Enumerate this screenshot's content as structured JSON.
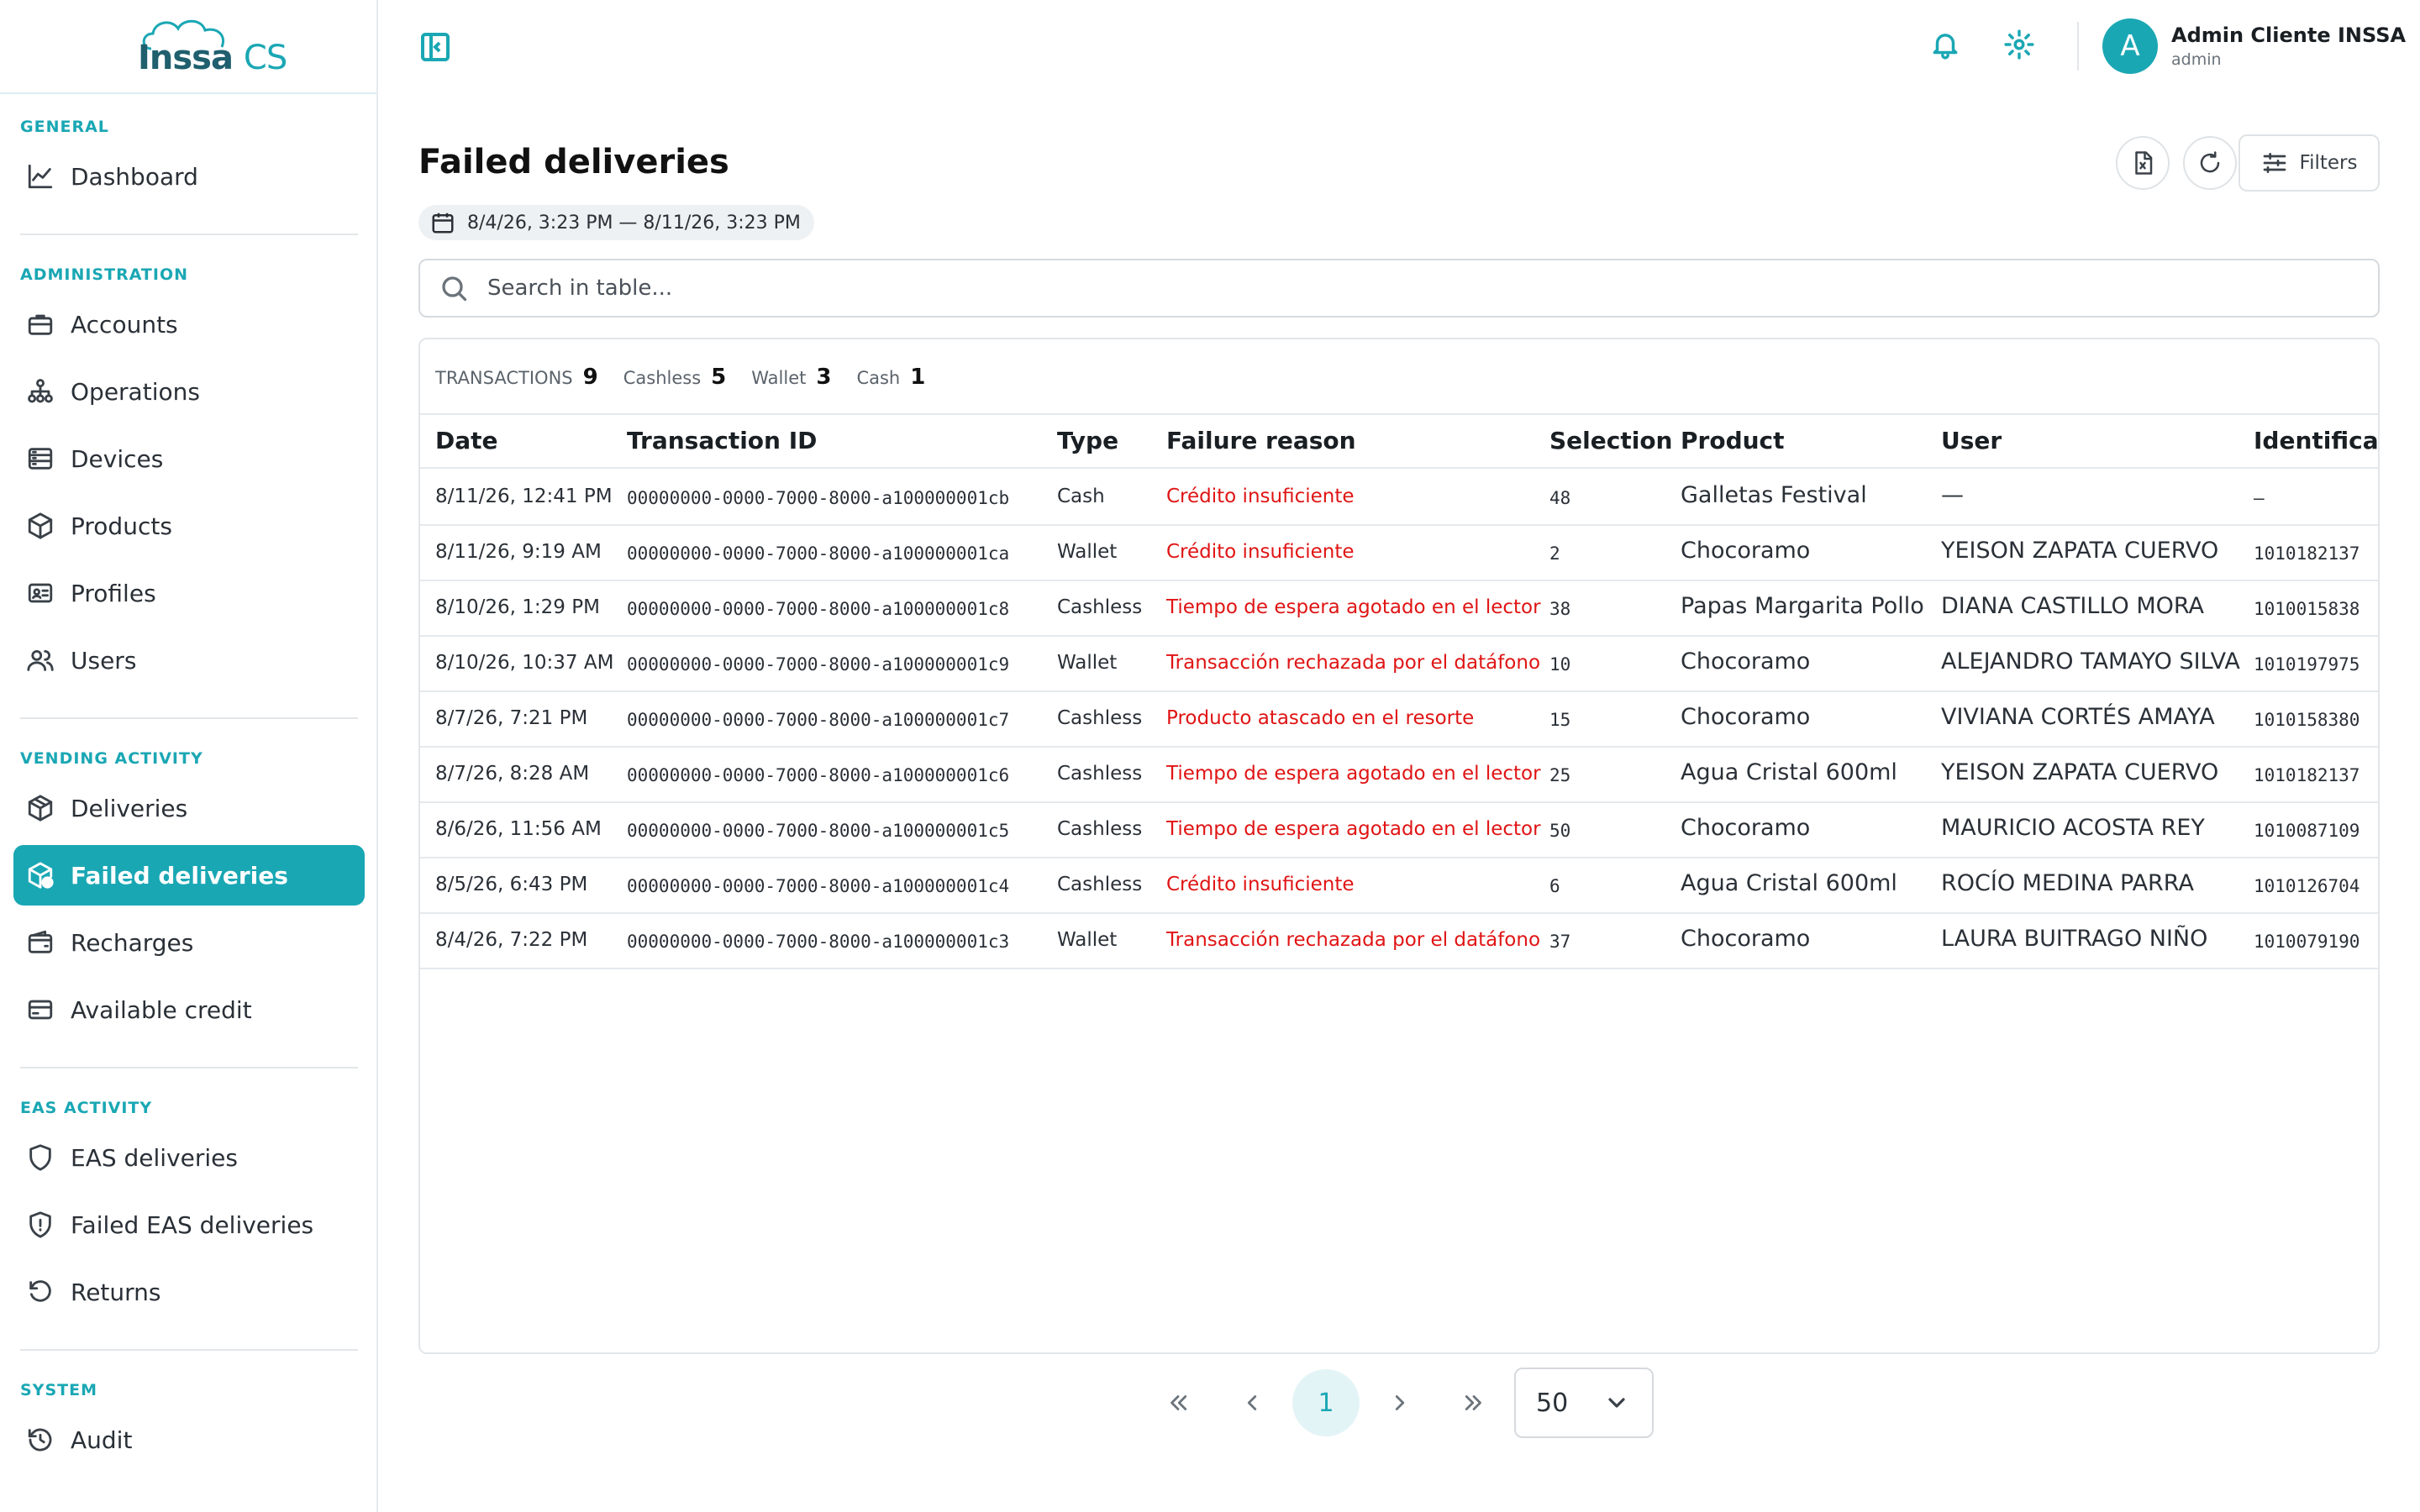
{
  "app": {
    "logo_main": "Inssa",
    "logo_suffix": "CS"
  },
  "sidebar": {
    "sections": [
      {
        "title": "GENERAL",
        "items": [
          {
            "label": "Dashboard",
            "icon": "chart-line-icon"
          }
        ]
      },
      {
        "title": "ADMINISTRATION",
        "items": [
          {
            "label": "Accounts",
            "icon": "briefcase-icon"
          },
          {
            "label": "Operations",
            "icon": "hierarchy-icon"
          },
          {
            "label": "Devices",
            "icon": "server-icon"
          },
          {
            "label": "Products",
            "icon": "box-icon"
          },
          {
            "label": "Profiles",
            "icon": "id-card-icon"
          },
          {
            "label": "Users",
            "icon": "users-icon"
          }
        ]
      },
      {
        "title": "VENDING ACTIVITY",
        "items": [
          {
            "label": "Deliveries",
            "icon": "package-icon"
          },
          {
            "label": "Failed deliveries",
            "icon": "package-alert-icon",
            "active": true
          },
          {
            "label": "Recharges",
            "icon": "wallet-icon"
          },
          {
            "label": "Available credit",
            "icon": "credit-card-icon"
          }
        ]
      },
      {
        "title": "EAS ACTIVITY",
        "items": [
          {
            "label": "EAS deliveries",
            "icon": "shield-icon"
          },
          {
            "label": "Failed EAS deliveries",
            "icon": "shield-alert-icon"
          },
          {
            "label": "Returns",
            "icon": "rotate-ccw-icon"
          }
        ]
      },
      {
        "title": "SYSTEM",
        "items": [
          {
            "label": "Audit",
            "icon": "history-icon"
          }
        ]
      }
    ]
  },
  "topbar": {
    "user_initial": "A",
    "user_name": "Admin Cliente INSSA",
    "user_role": "admin"
  },
  "page": {
    "title": "Failed deliveries",
    "date_range": "8/4/26, 3:23 PM — 8/11/26, 3:23 PM",
    "filters_label": "Filters"
  },
  "search": {
    "placeholder": "Search in table..."
  },
  "stats": {
    "transactions_label": "TRANSACTIONS",
    "transactions": "9",
    "cashless_label": "Cashless",
    "cashless": "5",
    "wallet_label": "Wallet",
    "wallet": "3",
    "cash_label": "Cash",
    "cash": "1"
  },
  "table": {
    "columns": [
      "Date",
      "Transaction ID",
      "Type",
      "Failure reason",
      "Selection",
      "Product",
      "User",
      "Identification"
    ],
    "rows": [
      [
        "8/11/26, 12:41 PM",
        "00000000-0000-7000-8000-a100000001cb",
        "Cash",
        "Crédito insuficiente",
        "48",
        "Galletas Festival",
        "—",
        "—"
      ],
      [
        "8/11/26, 9:19 AM",
        "00000000-0000-7000-8000-a100000001ca",
        "Wallet",
        "Crédito insuficiente",
        "2",
        "Chocoramo",
        "YEISON ZAPATA CUERVO",
        "1010182137"
      ],
      [
        "8/10/26, 1:29 PM",
        "00000000-0000-7000-8000-a100000001c8",
        "Cashless",
        "Tiempo de espera agotado en el lector",
        "38",
        "Papas Margarita Pollo",
        "DIANA CASTILLO MORA",
        "1010015838"
      ],
      [
        "8/10/26, 10:37 AM",
        "00000000-0000-7000-8000-a100000001c9",
        "Wallet",
        "Transacción rechazada por el datáfono",
        "10",
        "Chocoramo",
        "ALEJANDRO TAMAYO SILVA",
        "1010197975"
      ],
      [
        "8/7/26, 7:21 PM",
        "00000000-0000-7000-8000-a100000001c7",
        "Cashless",
        "Producto atascado en el resorte",
        "15",
        "Chocoramo",
        "VIVIANA CORTÉS AMAYA",
        "1010158380"
      ],
      [
        "8/7/26, 8:28 AM",
        "00000000-0000-7000-8000-a100000001c6",
        "Cashless",
        "Tiempo de espera agotado en el lector",
        "25",
        "Agua Cristal 600ml",
        "YEISON ZAPATA CUERVO",
        "1010182137"
      ],
      [
        "8/6/26, 11:56 AM",
        "00000000-0000-7000-8000-a100000001c5",
        "Cashless",
        "Tiempo de espera agotado en el lector",
        "50",
        "Chocoramo",
        "MAURICIO ACOSTA REY",
        "1010087109"
      ],
      [
        "8/5/26, 6:43 PM",
        "00000000-0000-7000-8000-a100000001c4",
        "Cashless",
        "Crédito insuficiente",
        "6",
        "Agua Cristal 600ml",
        "ROCÍO MEDINA PARRA",
        "1010126704"
      ],
      [
        "8/4/26, 7:22 PM",
        "00000000-0000-7000-8000-a100000001c3",
        "Wallet",
        "Transacción rechazada por el datáfono",
        "37",
        "Chocoramo",
        "LAURA BUITRAGO NIÑO",
        "1010079190"
      ]
    ]
  },
  "pagination": {
    "current_page": "1",
    "page_size": "50"
  },
  "colors": {
    "accent": "#1aa7b4",
    "error": "#e01414"
  }
}
